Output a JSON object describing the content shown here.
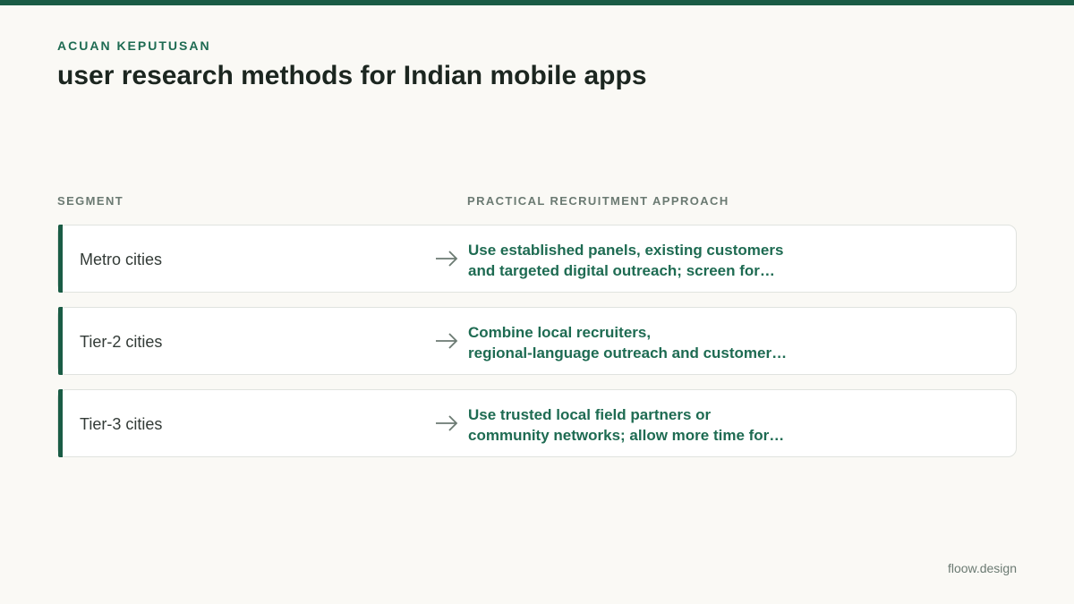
{
  "header": {
    "eyebrow": "ACUAN KEPUTUSAN",
    "title": "user research methods for Indian mobile apps"
  },
  "columns": {
    "segment": "SEGMENT",
    "approach": "PRACTICAL RECRUITMENT APPROACH"
  },
  "rows": [
    {
      "segment": "Metro cities",
      "approach_line1": "Use established panels, existing customers",
      "approach_line2": "and targeted digital outreach; screen for…"
    },
    {
      "segment": "Tier-2 cities",
      "approach_line1": "Combine local recruiters,",
      "approach_line2": "regional-language outreach and customer…"
    },
    {
      "segment": "Tier-3 cities",
      "approach_line1": "Use trusted local field partners or",
      "approach_line2": "community networks; allow more time for…"
    }
  ],
  "footer": {
    "brand": "floow.design"
  },
  "colors": {
    "accent": "#1a5c45",
    "accent_text": "#1e6b52",
    "background": "#faf9f5"
  },
  "icons": {
    "row_arrow": "right-arrow-icon"
  }
}
